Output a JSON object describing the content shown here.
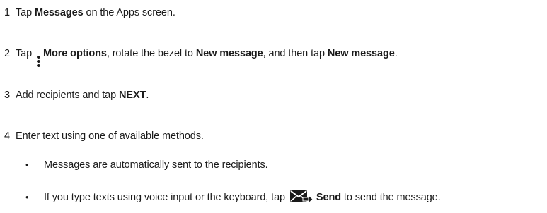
{
  "steps": [
    {
      "number": "1",
      "pre": "Tap ",
      "bold1": "Messages",
      "post": " on the Apps screen."
    },
    {
      "number": "2",
      "pre": "Tap ",
      "icon": "more-options-icon",
      "bold1": "More options",
      "mid1": ", rotate the bezel to ",
      "bold2": "New message",
      "mid2": ", and then tap ",
      "bold3": "New message",
      "post": "."
    },
    {
      "number": "3",
      "pre": "Add recipients and tap ",
      "bold1": "NEXT",
      "post": "."
    },
    {
      "number": "4",
      "text": "Enter text using one of available methods."
    }
  ],
  "bullets": [
    {
      "symbol": "•",
      "text": "Messages are automatically sent to the recipients."
    },
    {
      "symbol": "•",
      "pre": "If you type texts using voice input or the keyboard, tap ",
      "icon": "send-icon",
      "bold": "Send",
      "post": " to send the message."
    }
  ]
}
